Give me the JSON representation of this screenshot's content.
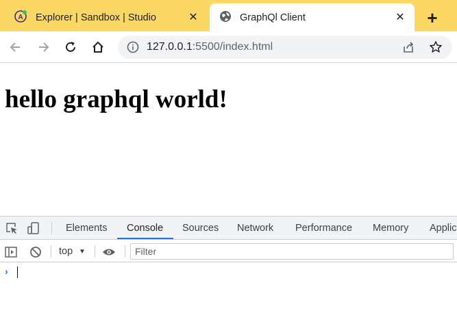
{
  "browser": {
    "tabs": [
      {
        "title": "Explorer | Sandbox | Studio",
        "favicon": "apollo-icon",
        "active": false
      },
      {
        "title": "GraphQl Client",
        "favicon": "globe-icon",
        "active": true
      }
    ],
    "address": {
      "host": "127.0.0.1",
      "path": ":5500/index.html"
    }
  },
  "page": {
    "heading": "hello graphql world!"
  },
  "devtools": {
    "tabs": [
      "Elements",
      "Console",
      "Sources",
      "Network",
      "Performance",
      "Memory",
      "Applic"
    ],
    "active_tab": "Console",
    "context": "top",
    "filter_placeholder": "Filter",
    "prompt_symbol": "›"
  },
  "colors": {
    "tabstrip": "#fbd866",
    "accent": "#1a73e8"
  }
}
